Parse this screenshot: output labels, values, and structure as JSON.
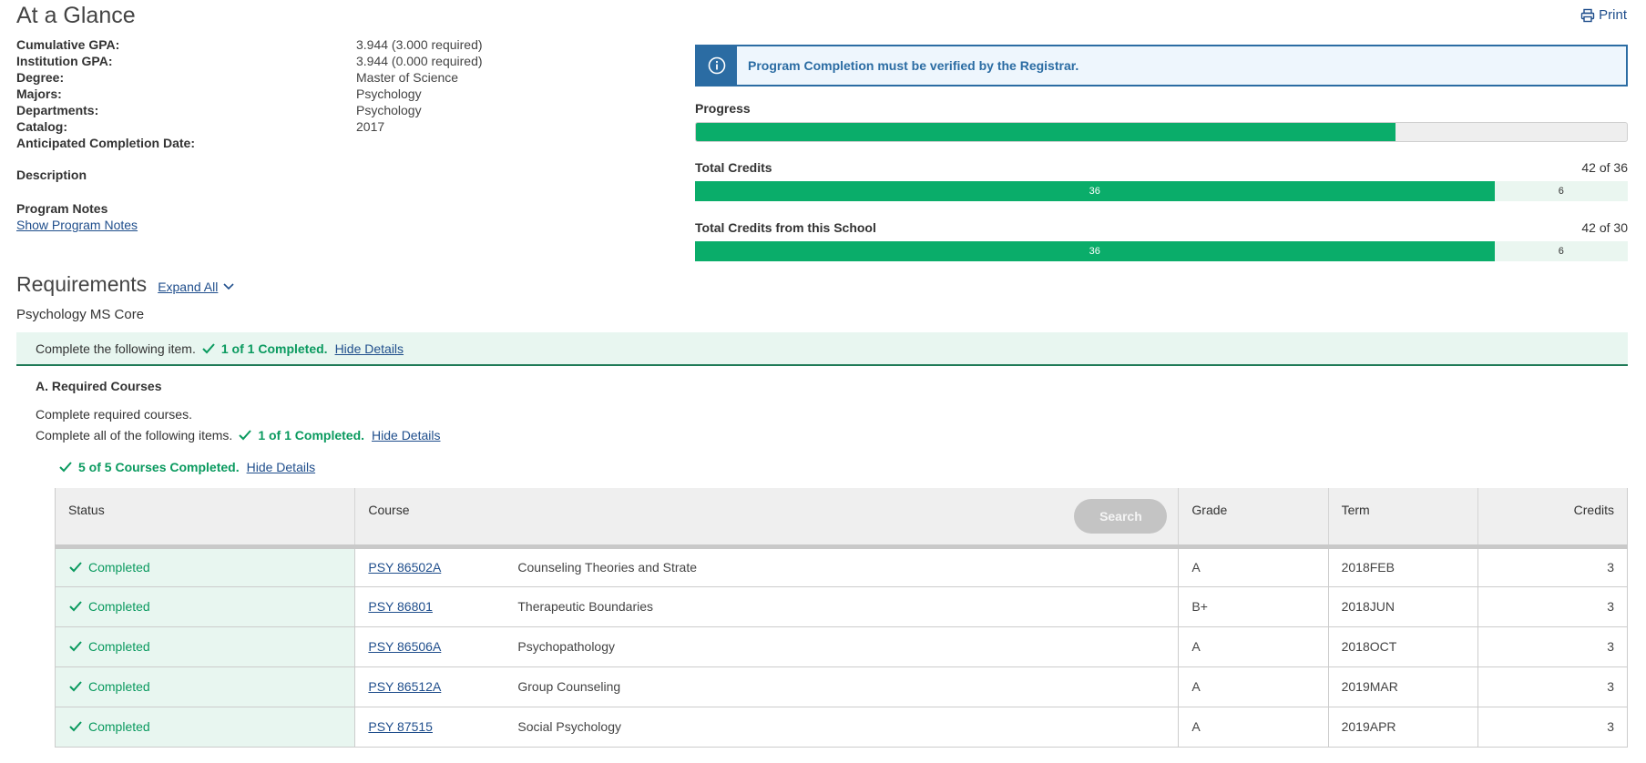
{
  "header": {
    "title": "At a Glance",
    "print_label": "Print"
  },
  "summary": [
    {
      "label": "Cumulative GPA:",
      "value": "3.944 (3.000 required)"
    },
    {
      "label": "Institution GPA:",
      "value": "3.944 (0.000 required)"
    },
    {
      "label": "Degree:",
      "value": "Master of Science"
    },
    {
      "label": "Majors:",
      "value": "Psychology"
    },
    {
      "label": "Departments:",
      "value": "Psychology"
    },
    {
      "label": "Catalog:",
      "value": "2017"
    },
    {
      "label": "Anticipated Completion Date:",
      "value": ""
    }
  ],
  "description": {
    "label": "Description"
  },
  "program_notes": {
    "label": "Program Notes",
    "link": "Show Program Notes"
  },
  "alert": {
    "message": "Program Completion must be verified by the Registrar."
  },
  "progress": {
    "label": "Progress",
    "fraction": 0.751
  },
  "total_credits": {
    "label": "Total Credits",
    "count": "42 of 36",
    "fill_value": "36",
    "rest_value": "6",
    "fill_fraction": 0.857
  },
  "school_credits": {
    "label": "Total Credits from this School",
    "count": "42 of 30",
    "fill_value": "36",
    "rest_value": "6",
    "fill_fraction": 0.857
  },
  "requirements": {
    "title": "Requirements",
    "expand_all": "Expand All",
    "program_name": "Psychology MS Core",
    "group": {
      "text": "Complete the following item.",
      "status": "1 of 1 Completed.",
      "hide": "Hide Details"
    },
    "section": {
      "title": "A. Required Courses",
      "desc": "Complete required courses.",
      "items_text": "Complete all of the following items.",
      "items_status": "1 of 1 Completed.",
      "items_hide": "Hide Details",
      "courses_status": "5 of 5 Courses Completed.",
      "courses_hide": "Hide Details"
    }
  },
  "table": {
    "headers": {
      "status": "Status",
      "course": "Course",
      "search": "Search",
      "grade": "Grade",
      "term": "Term",
      "credits": "Credits"
    },
    "rows": [
      {
        "status": "Completed",
        "code": "PSY 86502A",
        "title": "Counseling Theories and Strate",
        "grade": "A",
        "term": "2018FEB",
        "credits": "3"
      },
      {
        "status": "Completed",
        "code": "PSY 86801",
        "title": "Therapeutic Boundaries",
        "grade": "B+",
        "term": "2018JUN",
        "credits": "3"
      },
      {
        "status": "Completed",
        "code": "PSY 86506A",
        "title": "Psychopathology",
        "grade": "A",
        "term": "2018OCT",
        "credits": "3"
      },
      {
        "status": "Completed",
        "code": "PSY 86512A",
        "title": "Group Counseling",
        "grade": "A",
        "term": "2019MAR",
        "credits": "3"
      },
      {
        "status": "Completed",
        "code": "PSY 87515",
        "title": "Social Psychology",
        "grade": "A",
        "term": "2019APR",
        "credits": "3"
      }
    ]
  },
  "colors": {
    "accent": "#0aad6a",
    "link": "#1f4e8c",
    "info": "#2b6ca3",
    "success_bg": "#e8f6f0"
  }
}
